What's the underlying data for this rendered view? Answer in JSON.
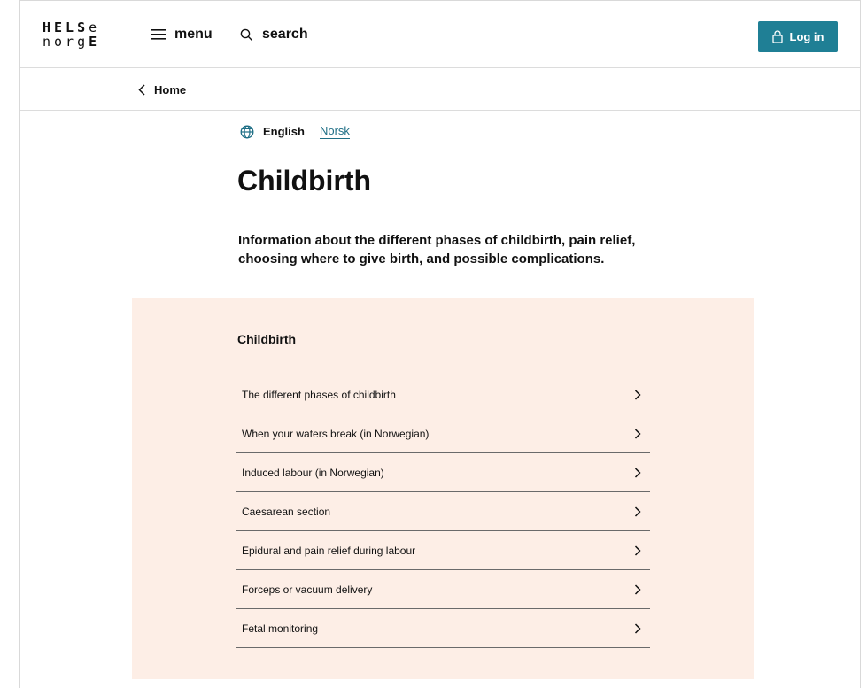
{
  "header": {
    "logo_line1": "HELSe",
    "logo_line2": "norgE",
    "menu_label": "menu",
    "search_label": "search",
    "login_label": "Log in",
    "accent_color": "#1f7f95"
  },
  "breadcrumb": {
    "home_label": "Home"
  },
  "language": {
    "current": "English",
    "alternate": "Norsk"
  },
  "page": {
    "title": "Childbirth",
    "lead": "Information about the different phases of childbirth, pain relief, choosing where to give birth, and possible complications."
  },
  "panel": {
    "title": "Childbirth",
    "background": "#fdeee6",
    "items": [
      {
        "label": "The different phases of childbirth"
      },
      {
        "label": "When your waters break (in Norwegian)"
      },
      {
        "label": "Induced labour (in Norwegian)"
      },
      {
        "label": "Caesarean section"
      },
      {
        "label": "Epidural and pain relief during labour"
      },
      {
        "label": "Forceps or vacuum delivery"
      },
      {
        "label": "Fetal monitoring"
      }
    ]
  },
  "icons": [
    "hamburger-icon",
    "search-icon",
    "lock-icon",
    "chevron-left-icon",
    "globe-icon",
    "chevron-right-icon"
  ]
}
